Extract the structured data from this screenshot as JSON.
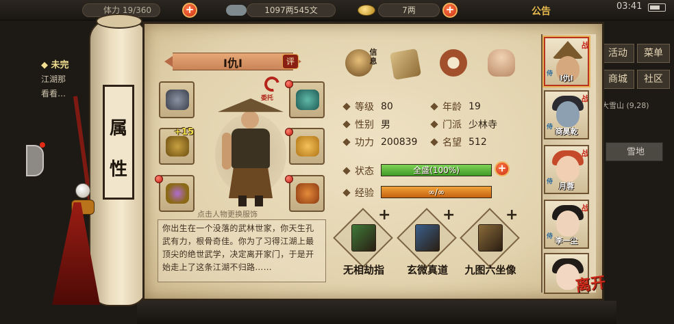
{
  "topbar": {
    "stamina_label": "体力",
    "stamina_value": "19/360",
    "money": "1097两545文",
    "gold": "7两",
    "notice": "公告",
    "time": "03:41"
  },
  "quest": {
    "title": "未完",
    "lines": [
      "江湖那",
      "看看…"
    ]
  },
  "right_menu": {
    "activity": "活动",
    "menu": "菜单",
    "shop": "商城",
    "community": "社区",
    "region": "大雪山",
    "region_coord": "(9,28)",
    "cell": "雪地"
  },
  "scroll": {
    "title_chars": [
      "属",
      "性"
    ]
  },
  "character": {
    "name": "I仇I",
    "rate_badge": "评",
    "tag_label": "委托",
    "hint": "点击人物更换服饰",
    "enhance": "+15",
    "bio": "你出生在一个没落的武林世家，你天生孔武有力，根骨奇佳。你为了习得江湖上最顶尖的绝世武学，决定离开家门，于是开始走上了这条江湖不归路……"
  },
  "tabs": {
    "info_label": "信息"
  },
  "stats": {
    "level_label": "等级",
    "level": "80",
    "age_label": "年龄",
    "age": "19",
    "gender_label": "性别",
    "gender": "男",
    "sect_label": "门派",
    "sect": "少林寺",
    "power_label": "功力",
    "power": "200839",
    "fame_label": "名望",
    "fame": "512",
    "status_label": "状态",
    "status_value": "全盛(100%)",
    "status_fraction": 1.0,
    "exp_label": "经验",
    "exp_value": "∞/∞",
    "exp_fraction": 1.0
  },
  "skills": [
    {
      "name": "无相劫指",
      "color": "#3f7a3a"
    },
    {
      "name": "玄微真道",
      "color": "#3a5f8c"
    },
    {
      "name": "九图六坐像",
      "color": "#8a6a3a"
    }
  ],
  "roster": [
    {
      "name": "I仇I",
      "badge": "战",
      "role": "侍"
    },
    {
      "name": "商昊乾",
      "badge": "战",
      "role": "侍"
    },
    {
      "name": "月蓉",
      "badge": "战",
      "role": "侍"
    },
    {
      "name": "李一尘",
      "badge": "战",
      "role": "侍"
    },
    {
      "name": "",
      "badge": "",
      "role": ""
    }
  ],
  "leave_label": "离开",
  "colors": {
    "accent_red": "#c6261a",
    "status_green": "#3f9a26",
    "exp_orange": "#c6620f",
    "parchment": "#e2d2ad"
  }
}
